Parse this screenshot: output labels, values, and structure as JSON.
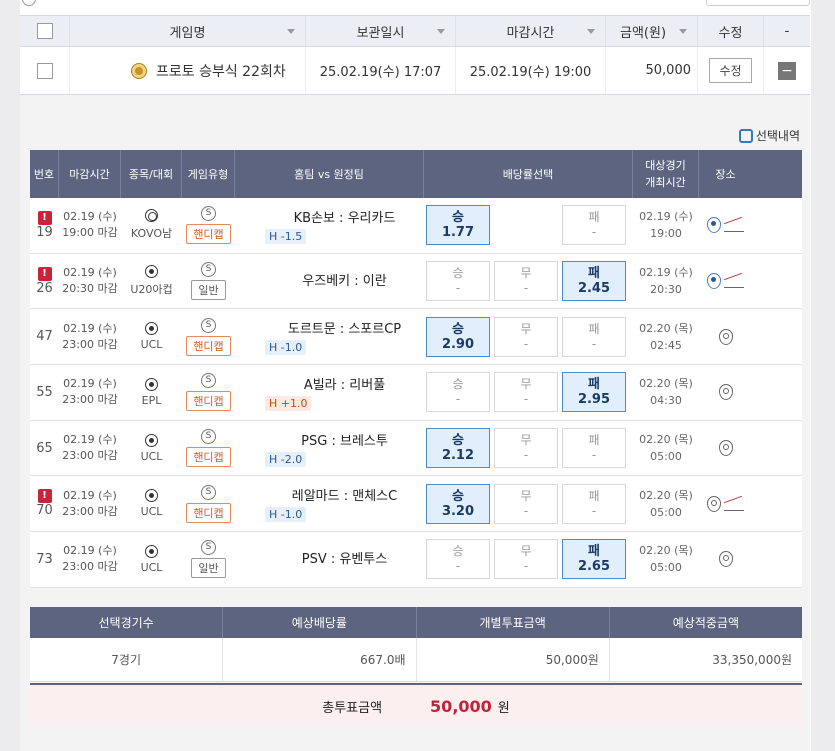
{
  "saved": {
    "headers": [
      "게임명",
      "보관일시",
      "마감시간",
      "금액(원)",
      "수정",
      "-"
    ],
    "row": {
      "game": "프로토 승부식 22회차",
      "saved_at": "25.02.19(수) 17:07",
      "deadline": "25.02.19(수) 19:00",
      "amount": "50,000",
      "edit_label": "수정",
      "delete_label": "−"
    }
  },
  "panel": {
    "select_link": "선택내역",
    "headers": {
      "no": "번호",
      "deadline": "마감시간",
      "sport": "종목/대회",
      "type": "게임유형",
      "match": "홈팀 vs 원정팀",
      "odds": "배당률선택",
      "date_l1": "대상경기",
      "date_l2": "개최시간",
      "place": "장소"
    },
    "rows": [
      {
        "no": "19",
        "alert": true,
        "d1": "02.19 (수)",
        "d2": "19:00 마감",
        "sport": "KOVO남",
        "ball": "volley",
        "type": "핸디캡",
        "handi": true,
        "match": "KB손보 : 우리카드",
        "hc": "H -1.5",
        "hc_kind": "minus",
        "odds": [
          {
            "l": "승",
            "v": "1.77",
            "sel": true
          },
          {
            "l": "",
            "v": "",
            "empty": true
          },
          {
            "l": "패",
            "v": "-",
            "sel": false
          }
        ],
        "date": "02.19 (수)",
        "time": "19:00",
        "star": true
      },
      {
        "no": "26",
        "alert": true,
        "d1": "02.19 (수)",
        "d2": "20:30 마감",
        "sport": "U20아컵",
        "ball": "soccer",
        "type": "일반",
        "handi": false,
        "match": "우즈베키 : 이란",
        "hc": "",
        "hc_kind": "",
        "odds": [
          {
            "l": "승",
            "v": "-",
            "sel": false
          },
          {
            "l": "무",
            "v": "-",
            "sel": false
          },
          {
            "l": "패",
            "v": "2.45",
            "sel": true
          }
        ],
        "date": "02.19 (수)",
        "time": "20:30",
        "star": true
      },
      {
        "no": "47",
        "alert": false,
        "d1": "02.19 (수)",
        "d2": "23:00 마감",
        "sport": "UCL",
        "ball": "soccer",
        "type": "핸디캡",
        "handi": true,
        "match": "도르트문 : 스포르CP",
        "hc": "H -1.0",
        "hc_kind": "minus",
        "odds": [
          {
            "l": "승",
            "v": "2.90",
            "sel": true
          },
          {
            "l": "무",
            "v": "-",
            "sel": false
          },
          {
            "l": "패",
            "v": "-",
            "sel": false
          }
        ],
        "date": "02.20 (목)",
        "time": "02:45",
        "star": false
      },
      {
        "no": "55",
        "alert": false,
        "d1": "02.19 (수)",
        "d2": "23:00 마감",
        "sport": "EPL",
        "ball": "soccer",
        "type": "핸디캡",
        "handi": true,
        "match": "A빌라 : 리버풀",
        "hc": "H +1.0",
        "hc_kind": "plus",
        "odds": [
          {
            "l": "승",
            "v": "-",
            "sel": false
          },
          {
            "l": "무",
            "v": "-",
            "sel": false
          },
          {
            "l": "패",
            "v": "2.95",
            "sel": true
          }
        ],
        "date": "02.20 (목)",
        "time": "04:30",
        "star": false
      },
      {
        "no": "65",
        "alert": false,
        "d1": "02.19 (수)",
        "d2": "23:00 마감",
        "sport": "UCL",
        "ball": "soccer",
        "type": "핸디캡",
        "handi": true,
        "match": "PSG : 브레스투",
        "hc": "H -2.0",
        "hc_kind": "minus",
        "odds": [
          {
            "l": "승",
            "v": "2.12",
            "sel": true
          },
          {
            "l": "무",
            "v": "-",
            "sel": false
          },
          {
            "l": "패",
            "v": "-",
            "sel": false
          }
        ],
        "date": "02.20 (목)",
        "time": "05:00",
        "star": false
      },
      {
        "no": "70",
        "alert": true,
        "d1": "02.19 (수)",
        "d2": "23:00 마감",
        "sport": "UCL",
        "ball": "soccer",
        "type": "핸디캡",
        "handi": true,
        "match": "레알마드 : 맨체스C",
        "hc": "H -1.0",
        "hc_kind": "minus",
        "odds": [
          {
            "l": "승",
            "v": "3.20",
            "sel": true
          },
          {
            "l": "무",
            "v": "-",
            "sel": false
          },
          {
            "l": "패",
            "v": "-",
            "sel": false
          }
        ],
        "date": "02.20 (목)",
        "time": "05:00",
        "star": false,
        "trend": true
      },
      {
        "no": "73",
        "alert": false,
        "d1": "02.19 (수)",
        "d2": "23:00 마감",
        "sport": "UCL",
        "ball": "soccer",
        "type": "일반",
        "handi": false,
        "match": "PSV : 유벤투스",
        "hc": "",
        "hc_kind": "",
        "odds": [
          {
            "l": "승",
            "v": "-",
            "sel": false
          },
          {
            "l": "무",
            "v": "-",
            "sel": false
          },
          {
            "l": "패",
            "v": "2.65",
            "sel": true
          }
        ],
        "date": "02.20 (목)",
        "time": "05:00",
        "star": false
      }
    ]
  },
  "summary": {
    "headers": [
      "선택경기수",
      "예상배당률",
      "개별투표금액",
      "예상적중금액"
    ],
    "values": [
      "7경기",
      "667.0배",
      "50,000원",
      "33,350,000원"
    ],
    "total_label": "총투표금액",
    "total_amount": "50,000",
    "total_unit": "원"
  }
}
